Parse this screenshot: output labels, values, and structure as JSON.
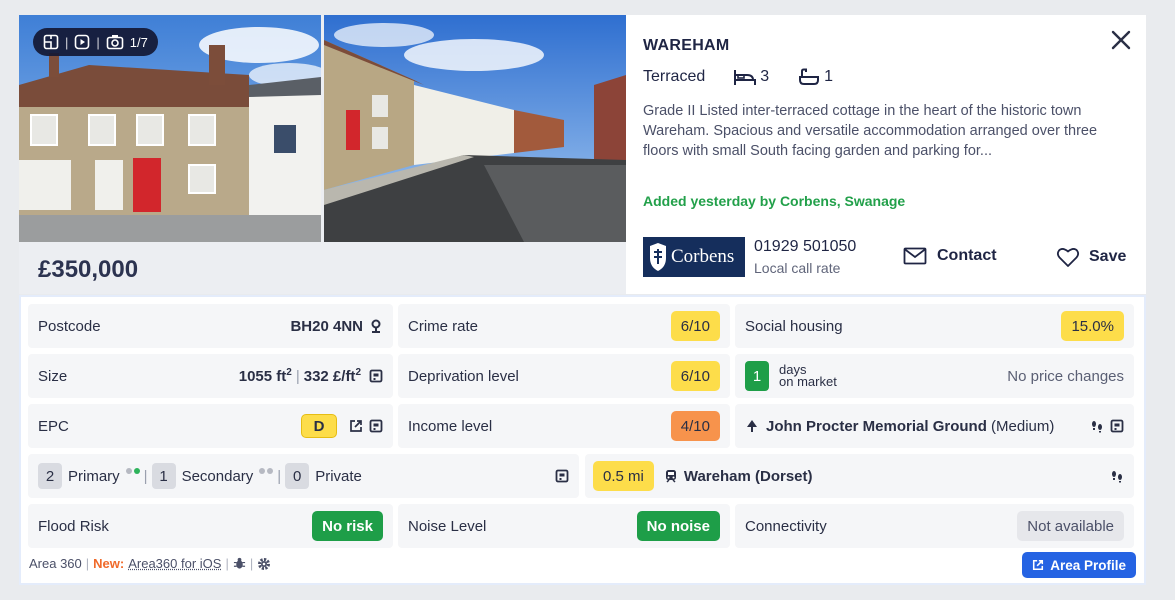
{
  "listing": {
    "media": {
      "counter": "1/7"
    },
    "price": "£350,000",
    "town": "WAREHAM",
    "property_type": "Terraced",
    "bedrooms": "3",
    "bathrooms": "1",
    "description": "Grade II Listed inter-terraced cottage in the heart of the historic town Wareham. Spacious and versatile accommodation arranged over three floors with small South facing garden and parking for...",
    "added": "Added yesterday by Corbens, Swanage",
    "agent": {
      "logo_text": "Corbens",
      "phone": "01929 501050",
      "phone_note": "Local call rate"
    },
    "contact_label": "Contact",
    "save_label": "Save"
  },
  "area": {
    "postcode": {
      "label": "Postcode",
      "value": "BH20 4NN"
    },
    "crime": {
      "label": "Crime rate",
      "value": "6/10"
    },
    "social": {
      "label": "Social housing",
      "value": "15.0%"
    },
    "size": {
      "label": "Size",
      "sqft": "1055 ft",
      "sqft_sup": "2",
      "price_per": "332 £/ft",
      "price_sup": "2"
    },
    "deprivation": {
      "label": "Deprivation level",
      "value": "6/10"
    },
    "market": {
      "days": "1",
      "days_word": "days",
      "on_market": "on market",
      "price_changes": "No price changes"
    },
    "epc": {
      "label": "EPC",
      "value": "D"
    },
    "income": {
      "label": "Income level",
      "value": "4/10"
    },
    "park": {
      "name": "John Procter Memorial Ground",
      "size": "(Medium)"
    },
    "schools": {
      "primary_count": "2",
      "primary_label": "Primary",
      "secondary_count": "1",
      "secondary_label": "Secondary",
      "private_count": "0",
      "private_label": "Private"
    },
    "station": {
      "distance": "0.5 mi",
      "name": "Wareham (Dorset)"
    },
    "flood": {
      "label": "Flood Risk",
      "value": "No risk"
    },
    "noise": {
      "label": "Noise Level",
      "value": "No noise"
    },
    "connectivity": {
      "label": "Connectivity",
      "value": "Not available"
    }
  },
  "footer": {
    "brand": "Area 360",
    "new_label": "New:",
    "ios_link": "Area360 for iOS",
    "area_profile_button": "Area Profile"
  },
  "colors": {
    "navy": "#1c2140",
    "green": "#1e9e48",
    "yellow": "#fddd4a",
    "orange": "#f7934c",
    "blue": "#2563e3",
    "new_orange": "#f06a2a"
  }
}
